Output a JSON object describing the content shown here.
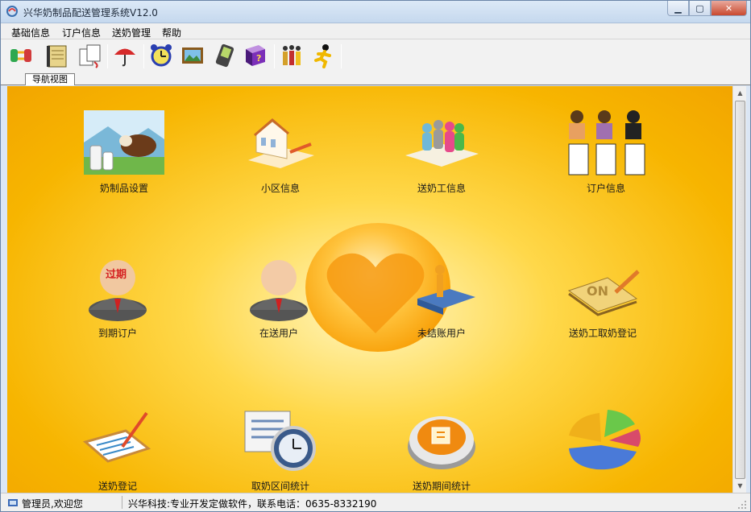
{
  "window": {
    "title": "兴华奶制品配送管理系统V12.0",
    "minimize": "▁",
    "maximize": "▢",
    "close": "✕"
  },
  "menu": [
    "基础信息",
    "订户信息",
    "送奶管理",
    "帮助"
  ],
  "toolbar": [
    "transfer-icon",
    "notebook-icon",
    "documents-icon",
    "umbrella-icon",
    "alarm-clock-icon",
    "picture-icon",
    "pda-icon",
    "help-book-icon",
    "people-icon",
    "running-man-icon"
  ],
  "tab": {
    "label": "导航视图"
  },
  "tiles": [
    {
      "label": "奶制品设置",
      "icon": "dairy-products-icon"
    },
    {
      "label": "小区信息",
      "icon": "community-building-icon"
    },
    {
      "label": "送奶工信息",
      "icon": "workers-group-icon"
    },
    {
      "label": "订户信息",
      "icon": "subscribers-icon"
    },
    {
      "label": "到期订户",
      "icon": "expired-user-icon",
      "badge": "过期"
    },
    {
      "label": "在送用户",
      "icon": "active-user-icon"
    },
    {
      "label": "未结账用户",
      "icon": "unpaid-user-icon"
    },
    {
      "label": "送奶工取奶登记",
      "icon": "pickup-register-icon",
      "badge": "ON"
    },
    {
      "label": "送奶登记",
      "icon": "delivery-register-icon"
    },
    {
      "label": "取奶区间统计",
      "icon": "pickup-stats-icon"
    },
    {
      "label": "送奶期间统计",
      "icon": "delivery-stats-icon"
    },
    {
      "label": "",
      "icon": "pie-chart-icon"
    }
  ],
  "status": {
    "user": "管理员,欢迎您",
    "info": "兴华科技:专业开发定做软件，联系电话：0635-8332190"
  },
  "colors": {
    "background": "#f7b500",
    "highlight": "#fff6c0"
  }
}
